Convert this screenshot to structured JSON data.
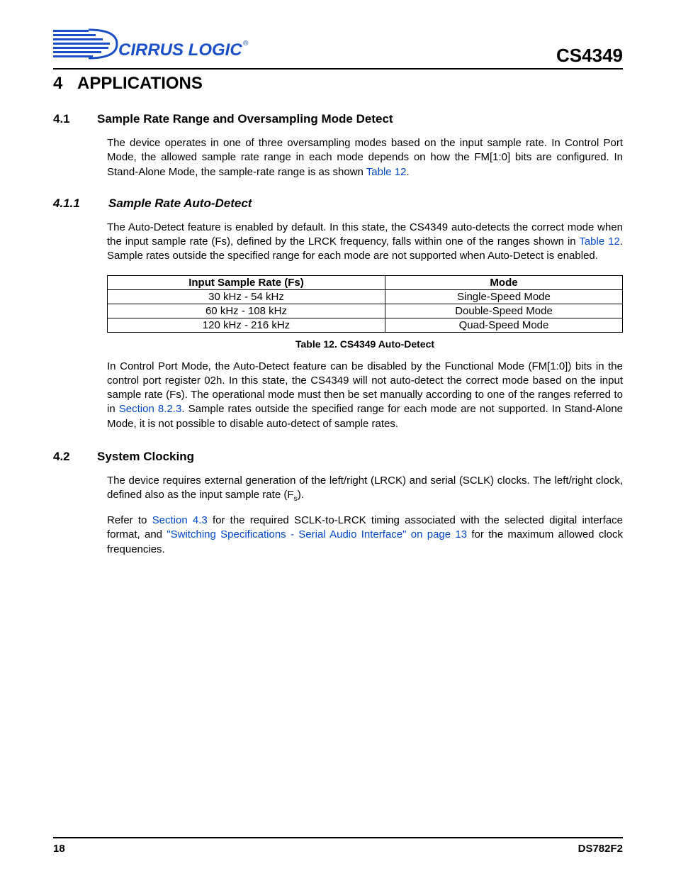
{
  "header": {
    "doc_id": "CS4349",
    "logo_text": "CIRRUS LOGIC",
    "logo_reg": "®"
  },
  "section4": {
    "num": "4",
    "title": "APPLICATIONS"
  },
  "section41": {
    "num": "4.1",
    "title": "Sample Rate Range and Oversampling Mode Detect",
    "p1a": "The device operates in one of three oversampling modes based on the input sample rate. In Control Port Mode, the allowed sample rate range in each mode depends on how the FM[1:0] bits are configured. In Stand-Alone Mode, the sample-rate range is as shown ",
    "p1link": "Table 12",
    "p1b": "."
  },
  "section411": {
    "num": "4.1.1",
    "title": "Sample Rate Auto-Detect",
    "p1a": "The Auto-Detect feature is enabled by default. In this state, the CS4349 auto-detects the correct mode when the input sample rate (Fs), defined by the LRCK frequency, falls within one of the ranges shown in ",
    "p1link": "Table 12",
    "p1b": ". Sample rates outside the specified range for each mode are not supported when Auto-Detect is enabled.",
    "p2a": "In Control Port Mode, the Auto-Detect feature can be disabled by the Functional Mode (FM[1:0]) bits in the control port register 02h. In this state, the CS4349 will not auto-detect the correct mode based on the input sample rate (Fs). The operational mode must then be set manually according to one of the ranges referred to in ",
    "p2link": "Section 8.2.3",
    "p2b": ". Sample rates outside the specified range for each mode are not supported. In Stand-Alone Mode, it is not possible to disable auto-detect of sample rates."
  },
  "table12": {
    "caption": "Table 12. CS4349 Auto-Detect",
    "headers": [
      "Input Sample Rate (Fs)",
      "Mode"
    ],
    "rows": [
      [
        "30 kHz - 54 kHz",
        "Single-Speed Mode"
      ],
      [
        "60 kHz - 108 kHz",
        "Double-Speed Mode"
      ],
      [
        "120 kHz - 216 kHz",
        "Quad-Speed Mode"
      ]
    ]
  },
  "section42": {
    "num": "4.2",
    "title": "System Clocking",
    "p1a": "The device requires external generation of the left/right (LRCK) and serial (SCLK) clocks. The left/right clock, defined also as the input sample rate (F",
    "p1sub": "s",
    "p1b": ").",
    "p2a": "Refer to ",
    "p2link1": "Section 4.3",
    "p2b": " for the required SCLK-to-LRCK timing associated with the selected digital interface format, and ",
    "p2link2": "\"Switching Specifications - Serial Audio Interface\" on page 13",
    "p2c": " for the maximum allowed clock frequencies."
  },
  "footer": {
    "page": "18",
    "doc": "DS782F2"
  }
}
